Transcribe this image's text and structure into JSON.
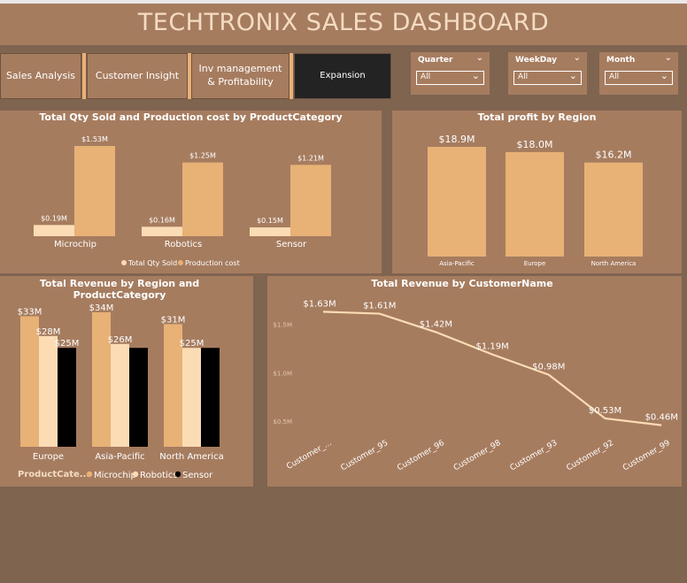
{
  "dashboard": {
    "title": "TECHTRONIX SALES DASHBOARD"
  },
  "nav": {
    "tabs": [
      {
        "label": "Sales Analysis"
      },
      {
        "label": "Customer Insight"
      },
      {
        "label": "Inv management & Profitability"
      },
      {
        "label": "Expansion"
      }
    ]
  },
  "filters": [
    {
      "label": "Quarter",
      "value": "All"
    },
    {
      "label": "WeekDay",
      "value": "All"
    },
    {
      "label": "Month",
      "value": "All"
    }
  ],
  "colors": {
    "background": "#7f6450",
    "panel": "#a67c5f",
    "microchip": "#e8b176",
    "robotics": "#fbdcb4",
    "sensor": "#000000",
    "title": "#f4dcc2",
    "accent": "#e8b176"
  },
  "icons": {
    "dropdown": "chevron-down-icon",
    "legend_marker": "dot-icon"
  },
  "chart_data": [
    {
      "id": "qty_cost",
      "type": "bar",
      "title": "Total Qty Sold and Production cost by ProductCategory",
      "categories": [
        "Microchip",
        "Robotics",
        "Sensor"
      ],
      "series": [
        {
          "name": "Total Qty Sold",
          "values": [
            0.19,
            0.16,
            0.15
          ],
          "labels": [
            "$0.19M",
            "$0.16M",
            "$0.15M"
          ]
        },
        {
          "name": "Production cost",
          "values": [
            1.53,
            1.25,
            1.21
          ],
          "labels": [
            "$1.53M",
            "$1.25M",
            "$1.21M"
          ]
        }
      ],
      "ylim": [
        0,
        1.53
      ]
    },
    {
      "id": "profit_region",
      "type": "bar",
      "title": "Total profit by Region",
      "categories": [
        "Asia-Pacific",
        "Europe",
        "North America"
      ],
      "values": [
        18.9,
        18.0,
        16.2
      ],
      "labels": [
        "$18.9M",
        "$18.0M",
        "$16.2M"
      ],
      "ylim": [
        0,
        18.9
      ]
    },
    {
      "id": "revenue_region_cat",
      "type": "bar",
      "title": "Total Revenue by Region and ProductCategory",
      "legend_title": "ProductCate...",
      "categories": [
        "Europe",
        "Asia-Pacific",
        "North America"
      ],
      "series": [
        {
          "name": "Microchip",
          "values": [
            33,
            34,
            31
          ],
          "labels": [
            "$33M",
            "$34M",
            "$31M"
          ]
        },
        {
          "name": "Robotics",
          "values": [
            28,
            26,
            25
          ],
          "labels": [
            "$28M",
            "$26M",
            "$25M"
          ]
        },
        {
          "name": "Sensor",
          "values": [
            25,
            25,
            25
          ],
          "labels": [
            "$25M",
            "",
            ""
          ]
        }
      ],
      "ylim": [
        0,
        34
      ]
    },
    {
      "id": "revenue_customer",
      "type": "line",
      "title": "Total Revenue by CustomerName",
      "x": [
        "Customer_...",
        "Customer_95",
        "Customer_96",
        "Customer_98",
        "Customer_93",
        "Customer_92",
        "Customer_99"
      ],
      "values": [
        1.63,
        1.61,
        1.42,
        1.19,
        0.98,
        0.53,
        0.46
      ],
      "labels": [
        "$1.63M",
        "$1.61M",
        "$1.42M",
        "$1.19M",
        "$0.98M",
        "$0.53M",
        "$0.46M"
      ],
      "yticks": [
        1.5,
        1.0,
        0.5
      ],
      "ytick_labels": [
        "$1.5M",
        "$1.0M",
        "$0.5M"
      ],
      "ylim": [
        0.42,
        1.67
      ]
    }
  ]
}
